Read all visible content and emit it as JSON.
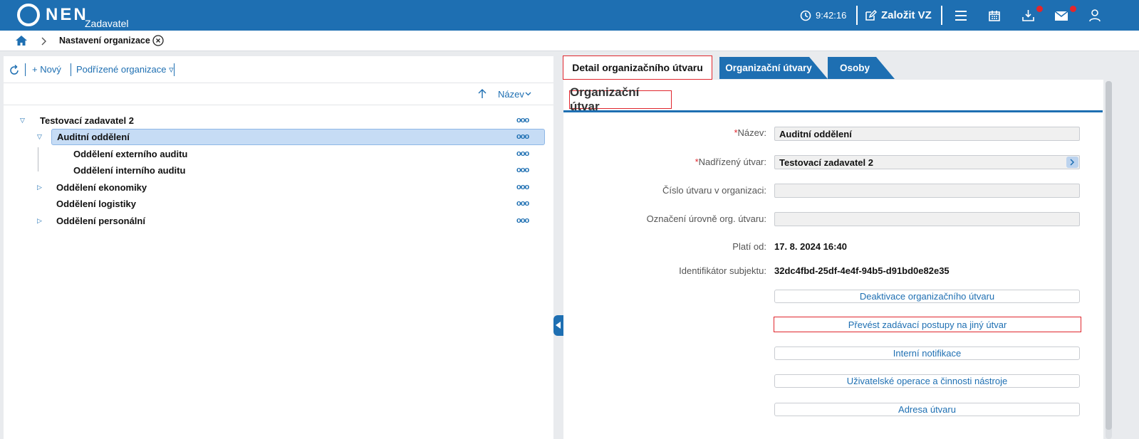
{
  "header": {
    "logo_text": "NEN",
    "logo_sub": "Zadavatel",
    "time": "9:42:16",
    "create_label": "Založit VZ"
  },
  "breadcrumb": {
    "title": "Nastavení organizace"
  },
  "left_toolbar": {
    "new_label": "+ Nový",
    "sub_orgs_label": "Podřízené organizace ▿"
  },
  "sort": {
    "label": "Název"
  },
  "tree": [
    {
      "label": "Testovací zadavatel 2"
    },
    {
      "label": "Auditní oddělení"
    },
    {
      "label": "Oddělení externího auditu"
    },
    {
      "label": "Oddělení interního auditu"
    },
    {
      "label": "Oddělení ekonomiky"
    },
    {
      "label": "Oddělení logistiky"
    },
    {
      "label": "Oddělení personální"
    }
  ],
  "tabs": {
    "active": "Detail organizačního útvaru",
    "t2": "Organizační útvary",
    "t3": "Osoby"
  },
  "section_title": "Organizační útvar",
  "fields": {
    "name_label": "Název:",
    "name_value": "Auditní oddělení",
    "parent_label": "Nadřízený útvar:",
    "parent_value": "Testovací zadavatel 2",
    "number_label": "Číslo útvaru v organizaci:",
    "level_label": "Označení úrovně org. útvaru:",
    "valid_label": "Platí od:",
    "valid_value": "17. 8. 2024 16:40",
    "id_label": "Identifikátor subjektu:",
    "id_value": "32dc4fbd-25df-4e4f-94b5-d91bd0e82e35"
  },
  "actions": {
    "deactivate": "Deaktivace organizačního útvaru",
    "transfer": "Převést zadávací postupy na jiný útvar",
    "notifications": "Interní notifikace",
    "user_ops": "Uživatelské operace a činnosti nástroje",
    "address": "Adresa útvaru"
  }
}
